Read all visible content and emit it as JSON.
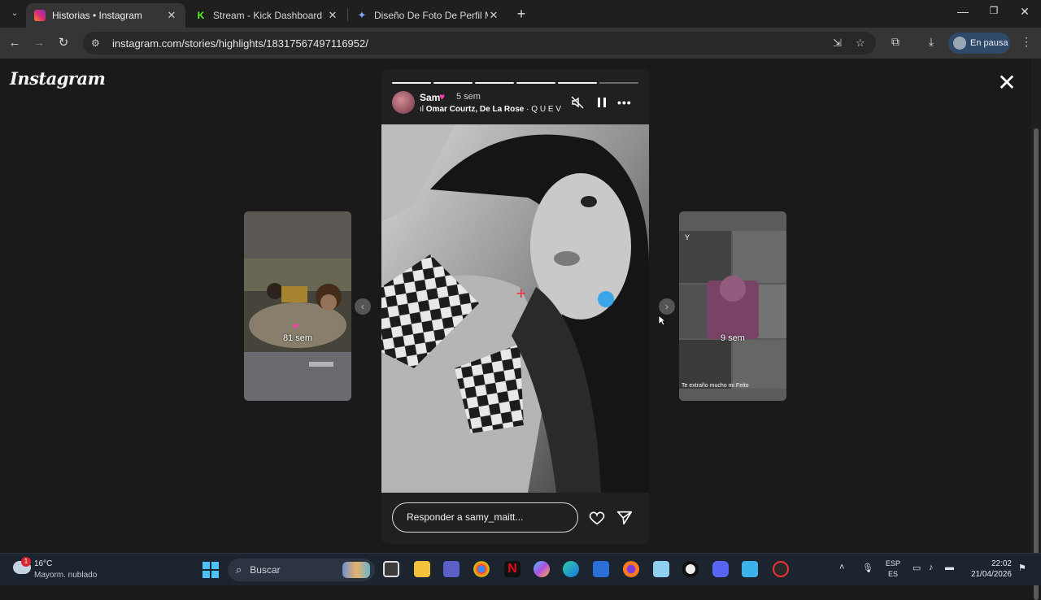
{
  "browser": {
    "tabs": [
      {
        "title": "Historias • Instagram",
        "active": true,
        "favicon_color": "#e1306c"
      },
      {
        "title": "Stream - Kick Dashboard",
        "active": false,
        "favicon_color": "#53fc18"
      },
      {
        "title": "Diseño De Foto De Perfil Minim",
        "active": false,
        "favicon_color": "#7aa7ff"
      }
    ],
    "url": "instagram.com/stories/highlights/18317567497116952/",
    "profile_label": "En pausa"
  },
  "page": {
    "logo": "Instagram",
    "left_preview": {
      "age": "81 sem"
    },
    "right_preview": {
      "age": "9 sem",
      "caption": "Te extraño mucho mi Feito"
    },
    "story": {
      "username": "Sam",
      "time": "5 sem",
      "music_artists": "Omar Courtz, De La Rose",
      "music_title": "· Q U E V A",
      "reply_placeholder": "Responder a samy_maitt...",
      "progress_total": 6,
      "progress_completed": 5
    }
  },
  "taskbar": {
    "weather_temp": "16°C",
    "weather_condition": "Mayorm. nublado",
    "weather_badge": "1",
    "search_placeholder": "Buscar",
    "lang_1": "ESP",
    "lang_2": "ES",
    "time": "22:02",
    "date": "21/04/2026"
  },
  "colors": {
    "accent_heart": "#ff3da8",
    "page_bg": "#1a1a1a",
    "profile_pill": "#2f4a69"
  }
}
